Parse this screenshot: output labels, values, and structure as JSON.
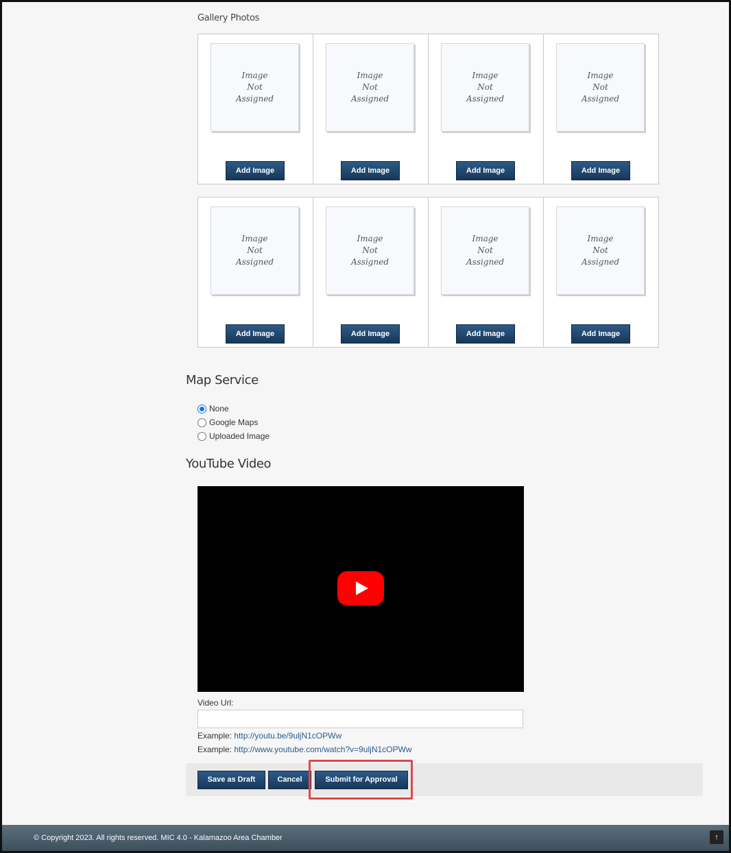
{
  "gallery": {
    "label": "Gallery Photos",
    "placeholder": [
      "Image",
      "Not",
      "Assigned"
    ],
    "add_label": "Add Image"
  },
  "map_service": {
    "title": "Map Service",
    "options": [
      "None",
      "Google Maps",
      "Uploaded Image"
    ],
    "selected": "None"
  },
  "youtube": {
    "title": "YouTube Video",
    "url_label": "Video Url:",
    "url_value": "",
    "example_prefix": "Example:",
    "example1": "http://youtu.be/9uljN1cOPWw",
    "example2": "http://www.youtube.com/watch?v=9uljN1cOPWw"
  },
  "actions": {
    "save_draft": "Save as Draft",
    "cancel": "Cancel",
    "submit": "Submit for Approval"
  },
  "footer": {
    "copyright": "© Copyright 2023. All rights reserved. MIC 4.0 - Kalamazoo Area Chamber",
    "top_glyph": "↑"
  },
  "colors": {
    "button": "#17375a",
    "highlight": "#e0474c",
    "youtube_red": "#ff0000"
  }
}
